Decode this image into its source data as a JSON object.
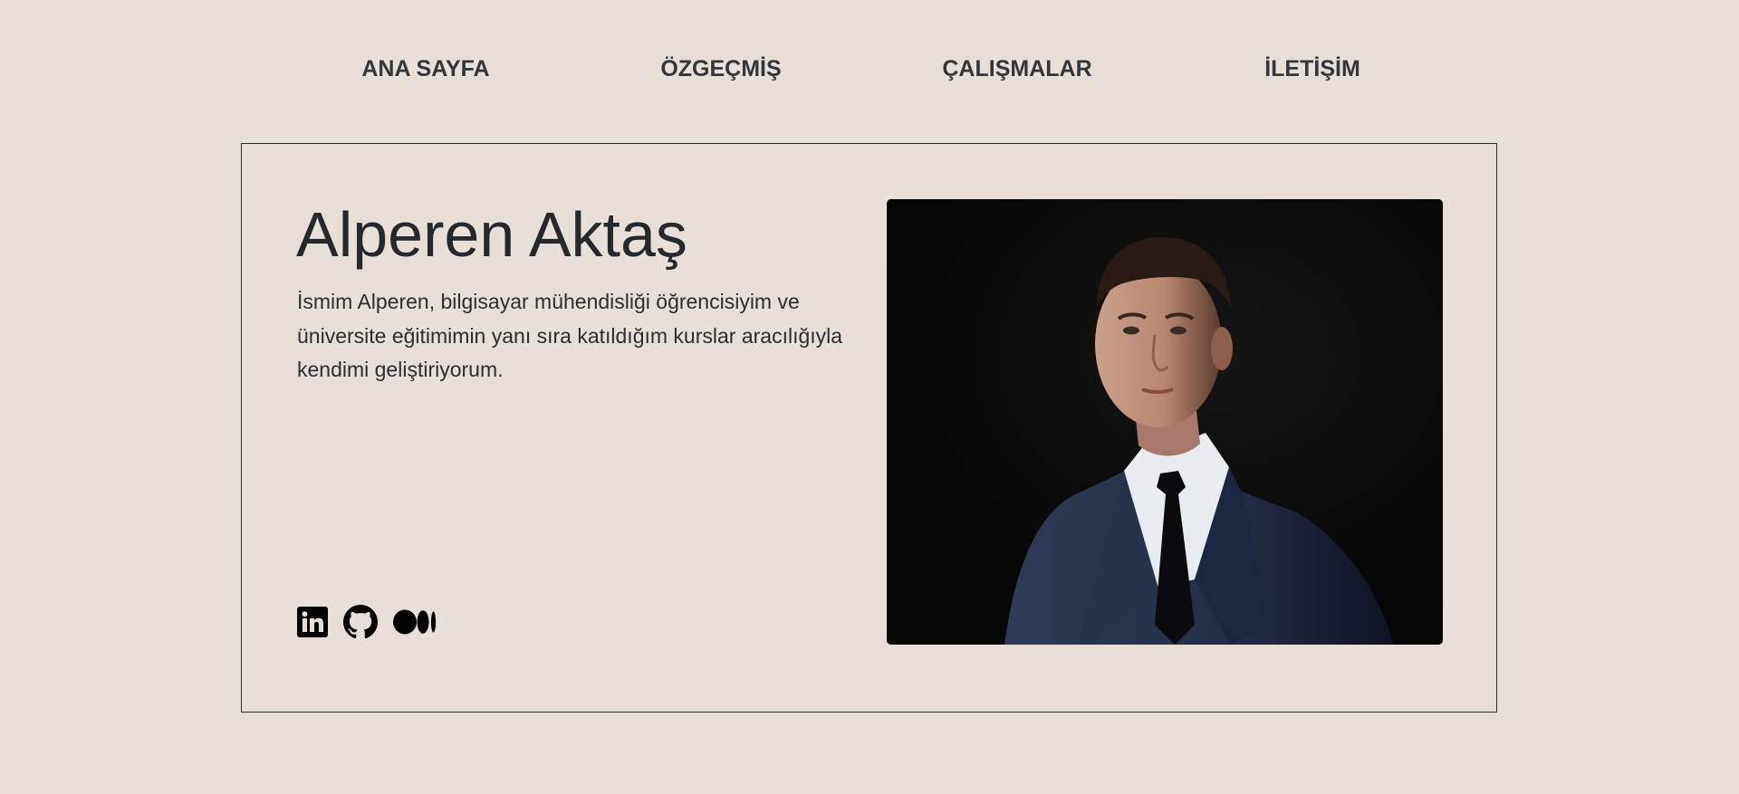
{
  "nav": {
    "items": [
      {
        "label": "ANA SAYFA"
      },
      {
        "label": "ÖZGEÇMİŞ"
      },
      {
        "label": "ÇALIŞMALAR"
      },
      {
        "label": "İLETİŞİM"
      }
    ]
  },
  "hero": {
    "name": "Alperen Aktaş",
    "bio": "İsmim Alperen, bilgisayar mühendisliği öğrencisiyim ve üniversite eğitimimin yanı sıra katıldığım kurslar aracılığıyla kendimi geliştiriyorum."
  },
  "socials": {
    "icons": [
      "linkedin-icon",
      "github-icon",
      "medium-icon"
    ]
  },
  "colors": {
    "background": "#e8dfd9",
    "text": "#272a2e",
    "border": "#2b2b2b"
  }
}
